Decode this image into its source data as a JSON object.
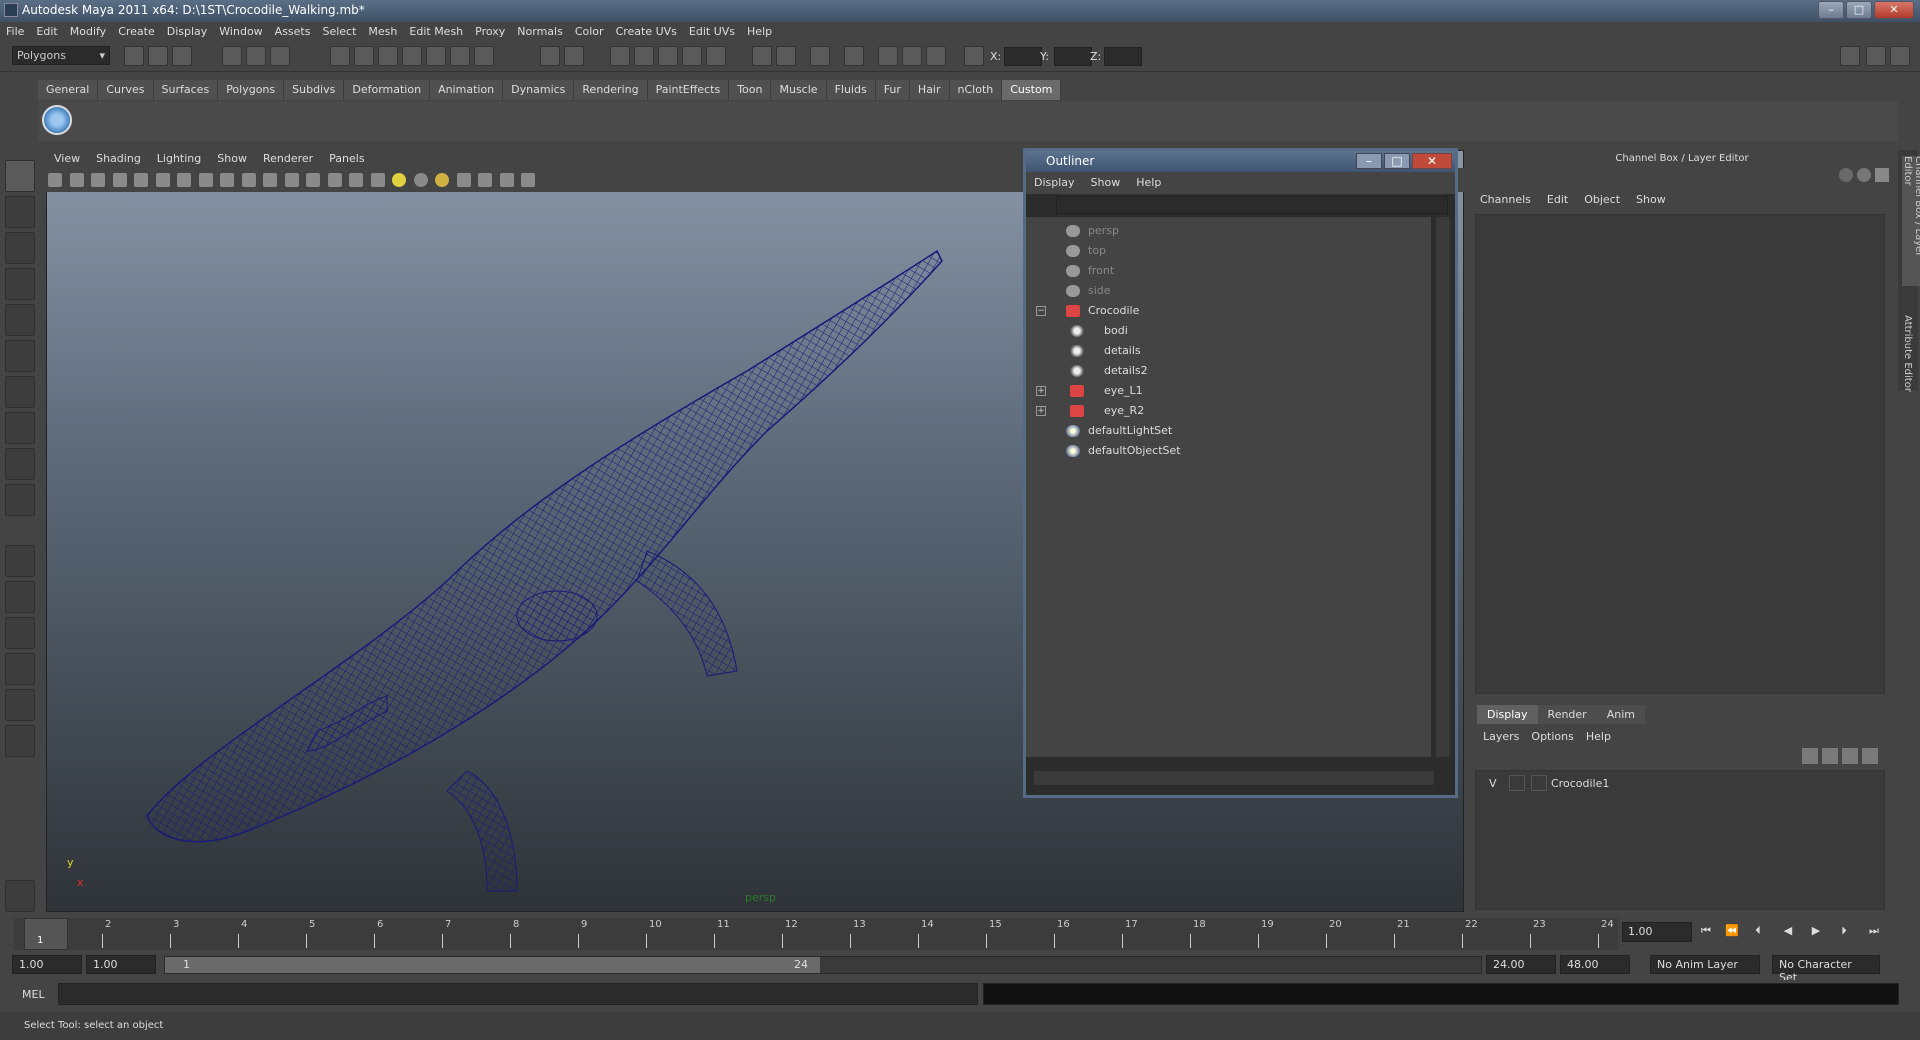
{
  "window": {
    "title": "Autodesk Maya 2011 x64: D:\\1ST\\Crocodile_Walking.mb*",
    "min": "–",
    "max": "□",
    "close": "✕"
  },
  "menubar": [
    "File",
    "Edit",
    "Modify",
    "Create",
    "Display",
    "Window",
    "Assets",
    "Select",
    "Mesh",
    "Edit Mesh",
    "Proxy",
    "Normals",
    "Color",
    "Create UVs",
    "Edit UVs",
    "Help"
  ],
  "statusline": {
    "menuset": "Polygons",
    "x_label": "X:",
    "y_label": "Y:",
    "z_label": "Z:"
  },
  "shelf_tabs": [
    "General",
    "Curves",
    "Surfaces",
    "Polygons",
    "Subdivs",
    "Deformation",
    "Animation",
    "Dynamics",
    "Rendering",
    "PaintEffects",
    "Toon",
    "Muscle",
    "Fluids",
    "Fur",
    "Hair",
    "nCloth",
    "Custom"
  ],
  "shelf_active": "Custom",
  "viewport": {
    "menu": [
      "View",
      "Shading",
      "Lighting",
      "Show",
      "Renderer",
      "Panels"
    ],
    "camera_label": "persp",
    "axis_y": "y",
    "axis_x": "x",
    "wire_color": "#1a1a7a"
  },
  "outliner": {
    "title": "Outliner",
    "menu": [
      "Display",
      "Show",
      "Help"
    ],
    "items": [
      {
        "label": "persp",
        "dim": true,
        "icon": "camera-icon",
        "indent": 0
      },
      {
        "label": "top",
        "dim": true,
        "icon": "camera-icon",
        "indent": 0
      },
      {
        "label": "front",
        "dim": true,
        "icon": "camera-icon",
        "indent": 0
      },
      {
        "label": "side",
        "dim": true,
        "icon": "camera-icon",
        "indent": 0
      },
      {
        "label": "Crocodile",
        "dim": false,
        "icon": "transform-icon",
        "indent": 0,
        "expander": "−"
      },
      {
        "label": "bodi",
        "dim": false,
        "icon": "mesh-icon",
        "indent": 1
      },
      {
        "label": "details",
        "dim": false,
        "icon": "mesh-icon",
        "indent": 1
      },
      {
        "label": "details2",
        "dim": false,
        "icon": "mesh-icon",
        "indent": 1
      },
      {
        "label": "eye_L1",
        "dim": false,
        "icon": "transform-icon",
        "indent": 1,
        "expander": "+"
      },
      {
        "label": "eye_R2",
        "dim": false,
        "icon": "transform-icon",
        "indent": 1,
        "expander": "+"
      },
      {
        "label": "defaultLightSet",
        "dim": false,
        "icon": "set-icon",
        "indent": 0
      },
      {
        "label": "defaultObjectSet",
        "dim": false,
        "icon": "set-icon",
        "indent": 0
      }
    ]
  },
  "channelbox": {
    "title": "Channel Box / Layer Editor",
    "menu": [
      "Channels",
      "Edit",
      "Object",
      "Show"
    ],
    "layer_tabs": [
      "Display",
      "Render",
      "Anim"
    ],
    "layer_tab_active": "Display",
    "layer_menu": [
      "Layers",
      "Options",
      "Help"
    ],
    "layer_row": {
      "visible": "V",
      "name": "Crocodile1"
    }
  },
  "side_tabs": [
    "Channel Box / Layer Editor",
    "Attribute Editor"
  ],
  "timeline": {
    "frames": [
      "1",
      "2",
      "3",
      "4",
      "5",
      "6",
      "7",
      "8",
      "9",
      "10",
      "11",
      "12",
      "13",
      "14",
      "15",
      "16",
      "17",
      "18",
      "19",
      "20",
      "21",
      "22",
      "23",
      "24"
    ],
    "current_frame_marker": "1",
    "current_time": "1.00"
  },
  "range": {
    "start": "1.00",
    "playback_start": "1.00",
    "handle_start": "1",
    "handle_end": "24",
    "playback_end": "24.00",
    "end": "48.00",
    "anim_layer": "No Anim Layer",
    "character_set": "No Character Set"
  },
  "cmdline": {
    "label": "MEL"
  },
  "helpline": "Select Tool: select an object"
}
